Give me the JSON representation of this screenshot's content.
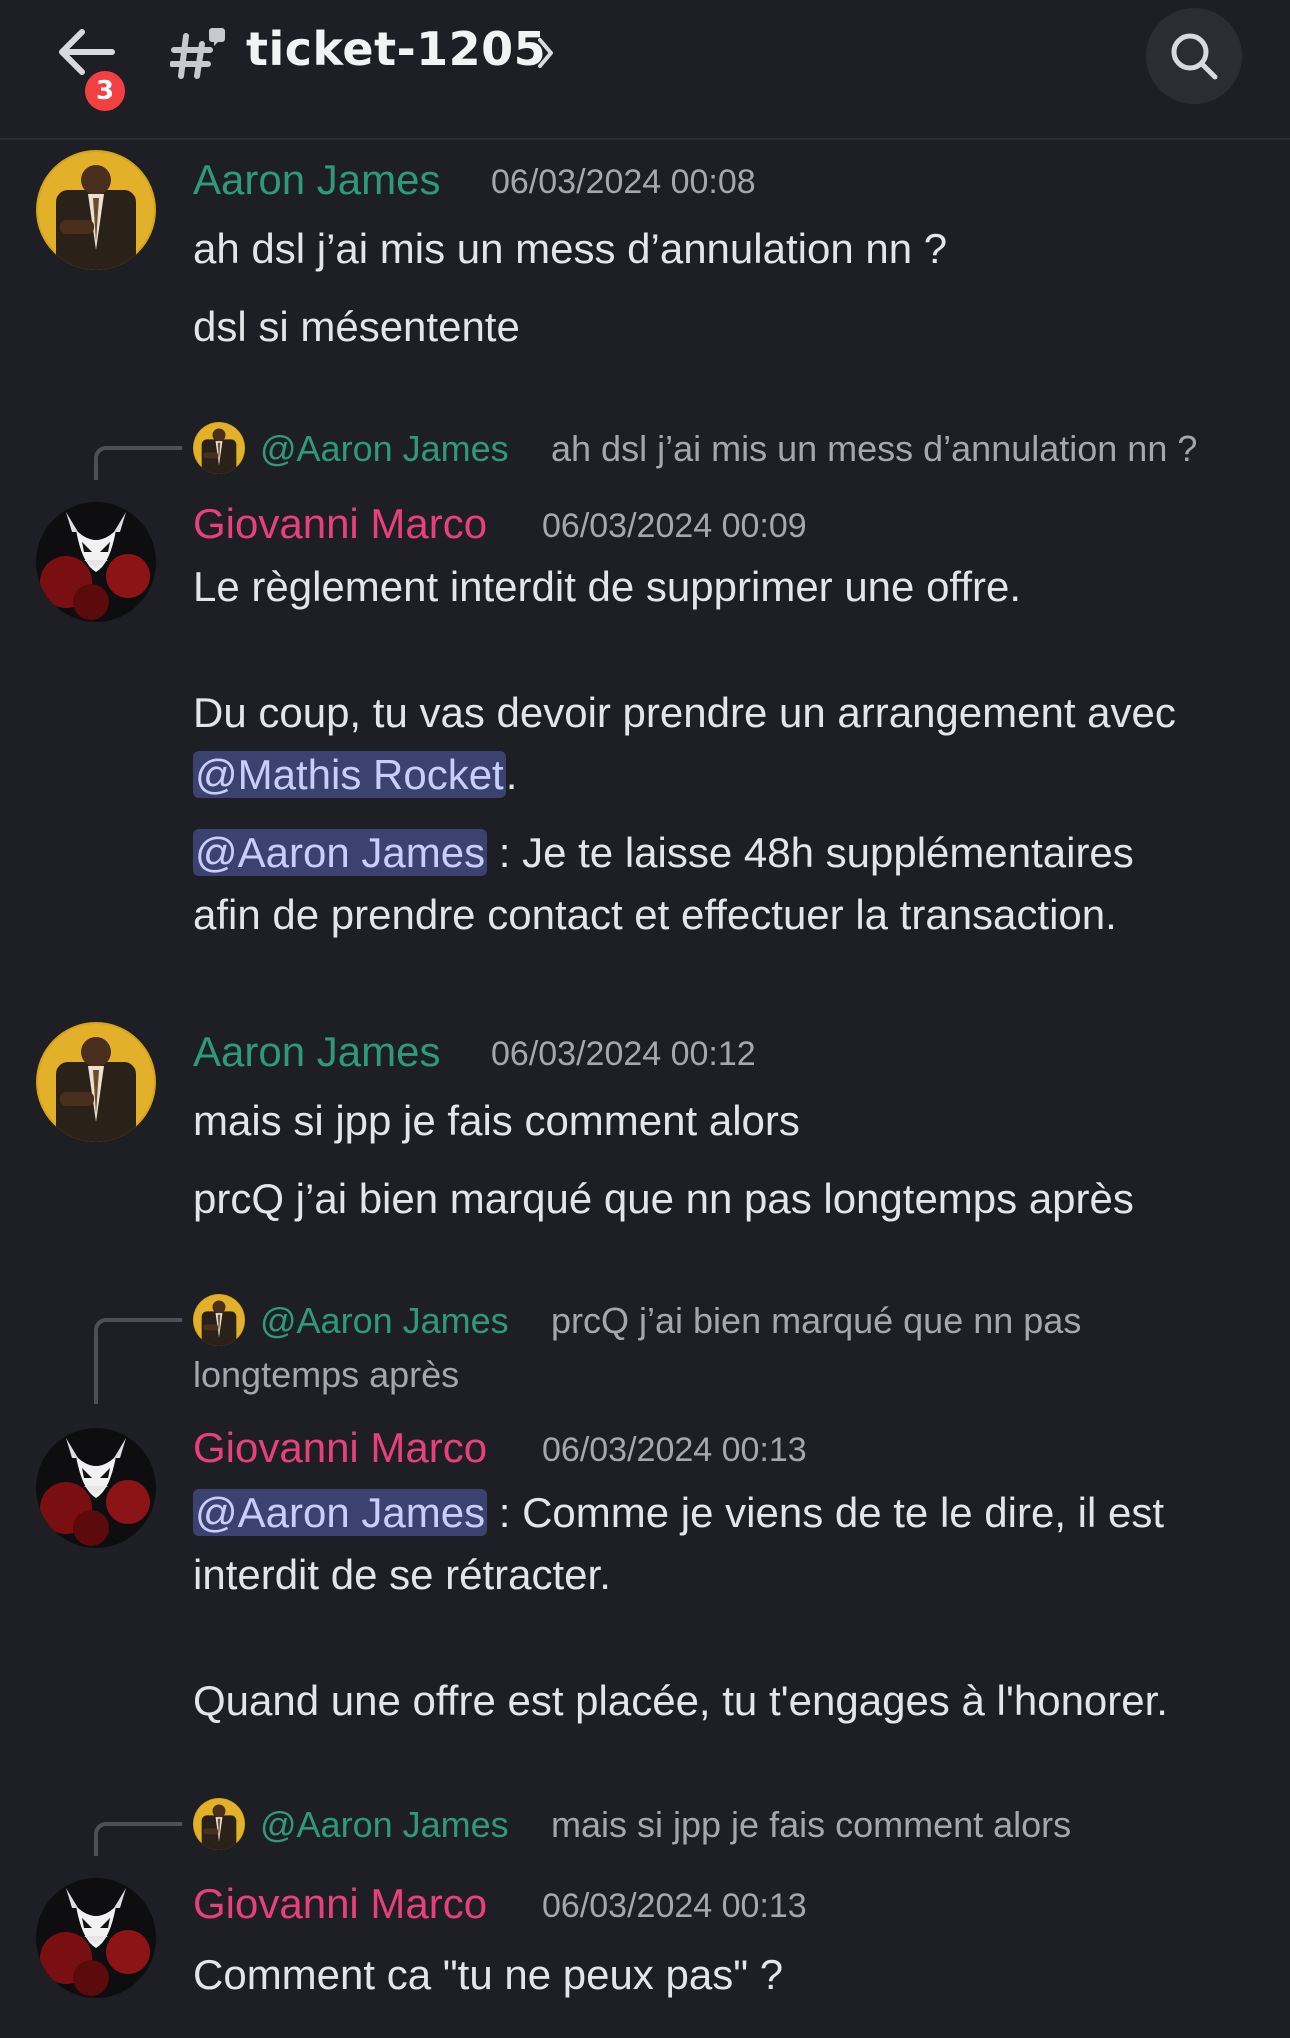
{
  "header": {
    "back_icon": "arrow-left-icon",
    "unread_badge": "3",
    "channel_icon": "hash-thread-icon",
    "channel_name": "ticket-1205",
    "chevron_icon": "chevron-right-icon",
    "search_icon": "search-icon"
  },
  "colors": {
    "background": "#1e1f24",
    "author_aaron": "#2f9a7b",
    "author_giovanni": "#e8407a",
    "mention_bg": "#3c4270",
    "badge": "#f23f42"
  },
  "messages": [
    {
      "author": "Aaron James",
      "timestamp": "06/03/2024 00:08",
      "lines": [
        "ah dsl j’ai mis un mess d’annulation nn ?",
        "dsl si mésentente"
      ]
    },
    {
      "reply_to": {
        "mention": "@Aaron James",
        "text": "ah dsl j’ai mis un mess d’annulation nn ?"
      },
      "author": "Giovanni Marco",
      "timestamp": "06/03/2024 00:09",
      "line1": "Le règlement interdit de supprimer une offre.",
      "line2": "Du coup, tu vas devoir prendre un arrangement avec",
      "mention1": "@Mathis Rocket",
      "after_mention1": ".",
      "mention2": "@Aaron James",
      "line3": " : Je te laisse 48h supplémentaires",
      "line4": "afin de prendre contact et effectuer la transaction."
    },
    {
      "author": "Aaron James",
      "timestamp": "06/03/2024 00:12",
      "lines": [
        "mais si jpp je fais comment alors",
        "prcQ j’ai bien marqué que nn pas longtemps après"
      ]
    },
    {
      "reply_to": {
        "mention": "@Aaron James",
        "text_line1": "prcQ j’ai bien marqué que nn pas",
        "text_line2": "longtemps après"
      },
      "author": "Giovanni Marco",
      "timestamp": "06/03/2024 00:13",
      "mention": "@Aaron James",
      "line1": " : Comme je viens de te le dire, il est",
      "line2": "interdit de se rétracter.",
      "line3": "Quand une offre est placée, tu t'engages à l'honorer."
    },
    {
      "reply_to": {
        "mention": "@Aaron James",
        "text": "mais si jpp je fais comment alors"
      },
      "author": "Giovanni Marco",
      "timestamp": "06/03/2024 00:13",
      "line1": "Comment ca \"tu ne peux pas\" ?"
    }
  ]
}
